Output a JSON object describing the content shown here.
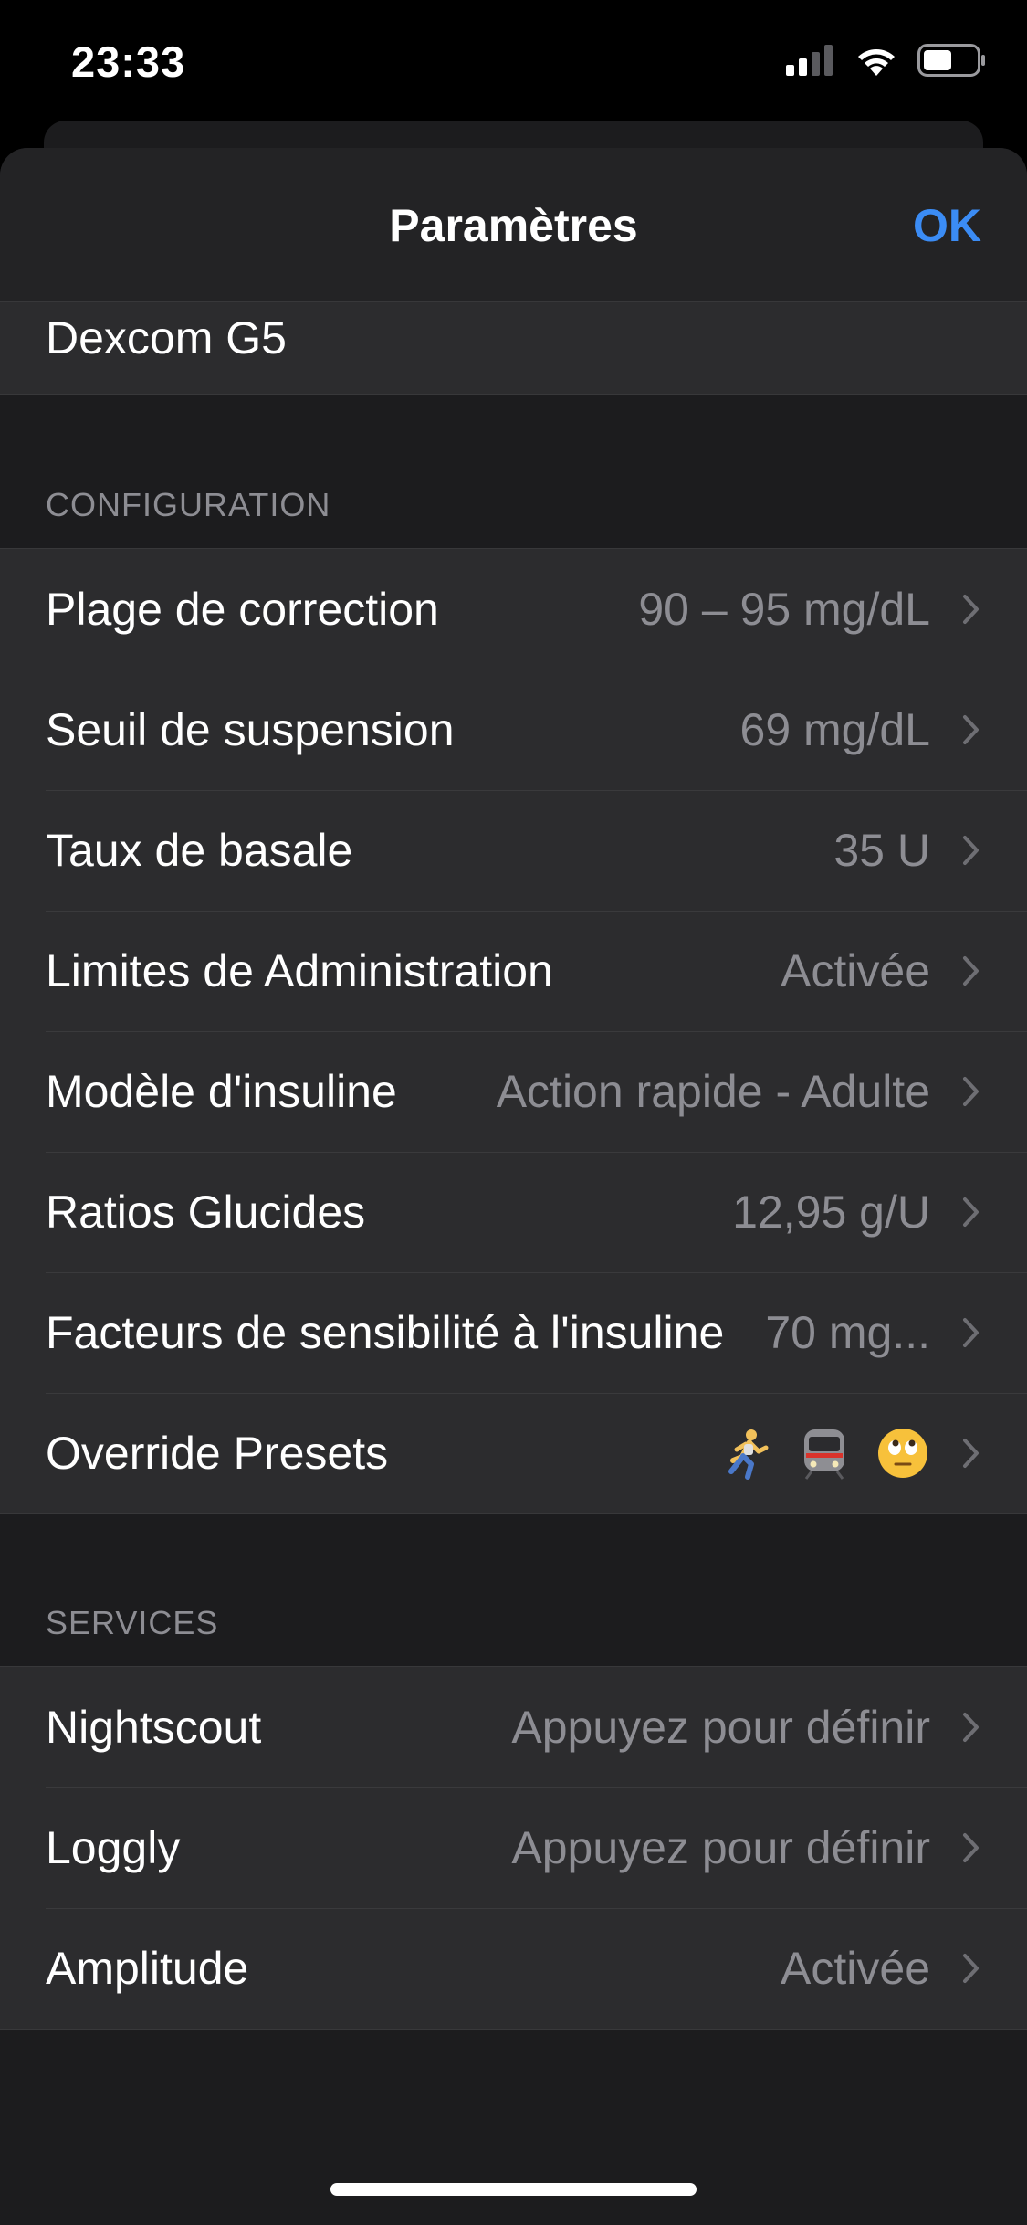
{
  "status_bar": {
    "time": "23:33",
    "signal_icon": "cellular-signal-icon",
    "wifi_icon": "wifi-icon",
    "battery_icon": "battery-icon"
  },
  "nav": {
    "title": "Paramètres",
    "ok_label": "OK",
    "accent_color": "#3b8cf5"
  },
  "device": {
    "label": "Dexcom G5"
  },
  "configuration": {
    "header": "CONFIGURATION",
    "rows": [
      {
        "label": "Plage de correction",
        "value": "90 – 95 mg/dL"
      },
      {
        "label": "Seuil de suspension",
        "value": "69 mg/dL"
      },
      {
        "label": "Taux de basale",
        "value": "35 U"
      },
      {
        "label": "Limites de Administration",
        "value": "Activée"
      },
      {
        "label": "Modèle d'insuline",
        "value": "Action rapide - Adulte"
      },
      {
        "label": "Ratios Glucides",
        "value": "12,95 g/U"
      },
      {
        "label": "Facteurs de sensibilité à l'insuline",
        "value": "70 mg..."
      },
      {
        "label": "Override Presets",
        "emojis": [
          "running-person-emoji",
          "train-emoji",
          "eye-roll-face-emoji"
        ]
      }
    ]
  },
  "services": {
    "header": "SERVICES",
    "rows": [
      {
        "label": "Nightscout",
        "value": "Appuyez pour définir"
      },
      {
        "label": "Loggly",
        "value": "Appuyez pour définir"
      },
      {
        "label": "Amplitude",
        "value": "Activée"
      }
    ]
  }
}
